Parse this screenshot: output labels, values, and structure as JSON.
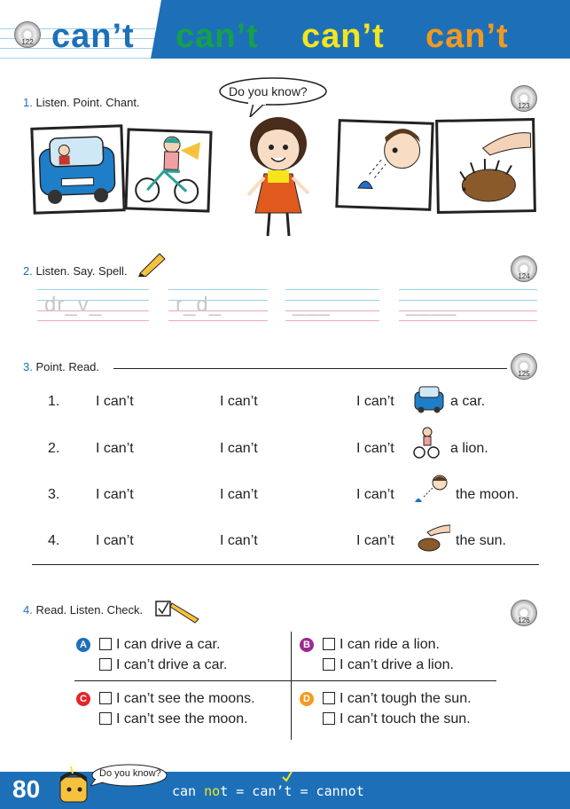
{
  "header": {
    "cd_number": "122",
    "words": [
      {
        "text": "can’t",
        "color": "#1d70b8"
      },
      {
        "text": "can’t",
        "color": "#15a04a"
      },
      {
        "text": "can’t",
        "color": "#f6e51c"
      },
      {
        "text": "can’t",
        "color": "#f39a1e"
      }
    ]
  },
  "section1": {
    "number": "1.",
    "title": "Listen. Point. Chant.",
    "cd_number": "123",
    "bubble": "Do you know?"
  },
  "section2": {
    "number": "2.",
    "title": "Listen. Say. Spell.",
    "cd_number": "124",
    "words": [
      "dr_v_",
      "r_d_",
      "___",
      "____"
    ]
  },
  "section3": {
    "number": "3.",
    "title": "Point. Read.",
    "cd_number": "125",
    "rows": [
      {
        "num": "1.",
        "c1": "I can’t",
        "c2": "I can’t",
        "c3": "I can’t",
        "end": "a car.",
        "icon": "car-icon"
      },
      {
        "num": "2.",
        "c1": "I can’t",
        "c2": "I can’t",
        "c3": "I can’t",
        "end": "a lion.",
        "icon": "bike-icon"
      },
      {
        "num": "3.",
        "c1": "I can’t",
        "c2": "I can’t",
        "c3": "I can’t",
        "end": "the moon.",
        "icon": "boy-looking-icon"
      },
      {
        "num": "4.",
        "c1": "I can’t",
        "c2": "I can’t",
        "c3": "I can’t",
        "end": "the sun.",
        "icon": "hedgehog-icon"
      }
    ]
  },
  "section4": {
    "number": "4.",
    "title": "Read. Listen. Check.",
    "cd_number": "126",
    "groups": [
      {
        "letter": "A",
        "color": "#1d70b8",
        "options": [
          "I can drive a car.",
          "I can’t drive a car."
        ]
      },
      {
        "letter": "B",
        "color": "#9b2a8f",
        "options": [
          "I can ride a lion.",
          "I can’t drive a lion."
        ]
      },
      {
        "letter": "C",
        "color": "#e0262b",
        "options": [
          "I can’t see the moons.",
          "I can’t see the moon."
        ]
      },
      {
        "letter": "D",
        "color": "#f39a1e",
        "options": [
          "I can’t tough the sun.",
          "I can’t touch the sun."
        ]
      }
    ]
  },
  "footer": {
    "page_number": "80",
    "bubble": "Do you know?",
    "formula_part1": "can ",
    "formula_highlight": "no",
    "formula_part2": "t = can’t = cannot",
    "highlight_color": "#f6e51c"
  }
}
